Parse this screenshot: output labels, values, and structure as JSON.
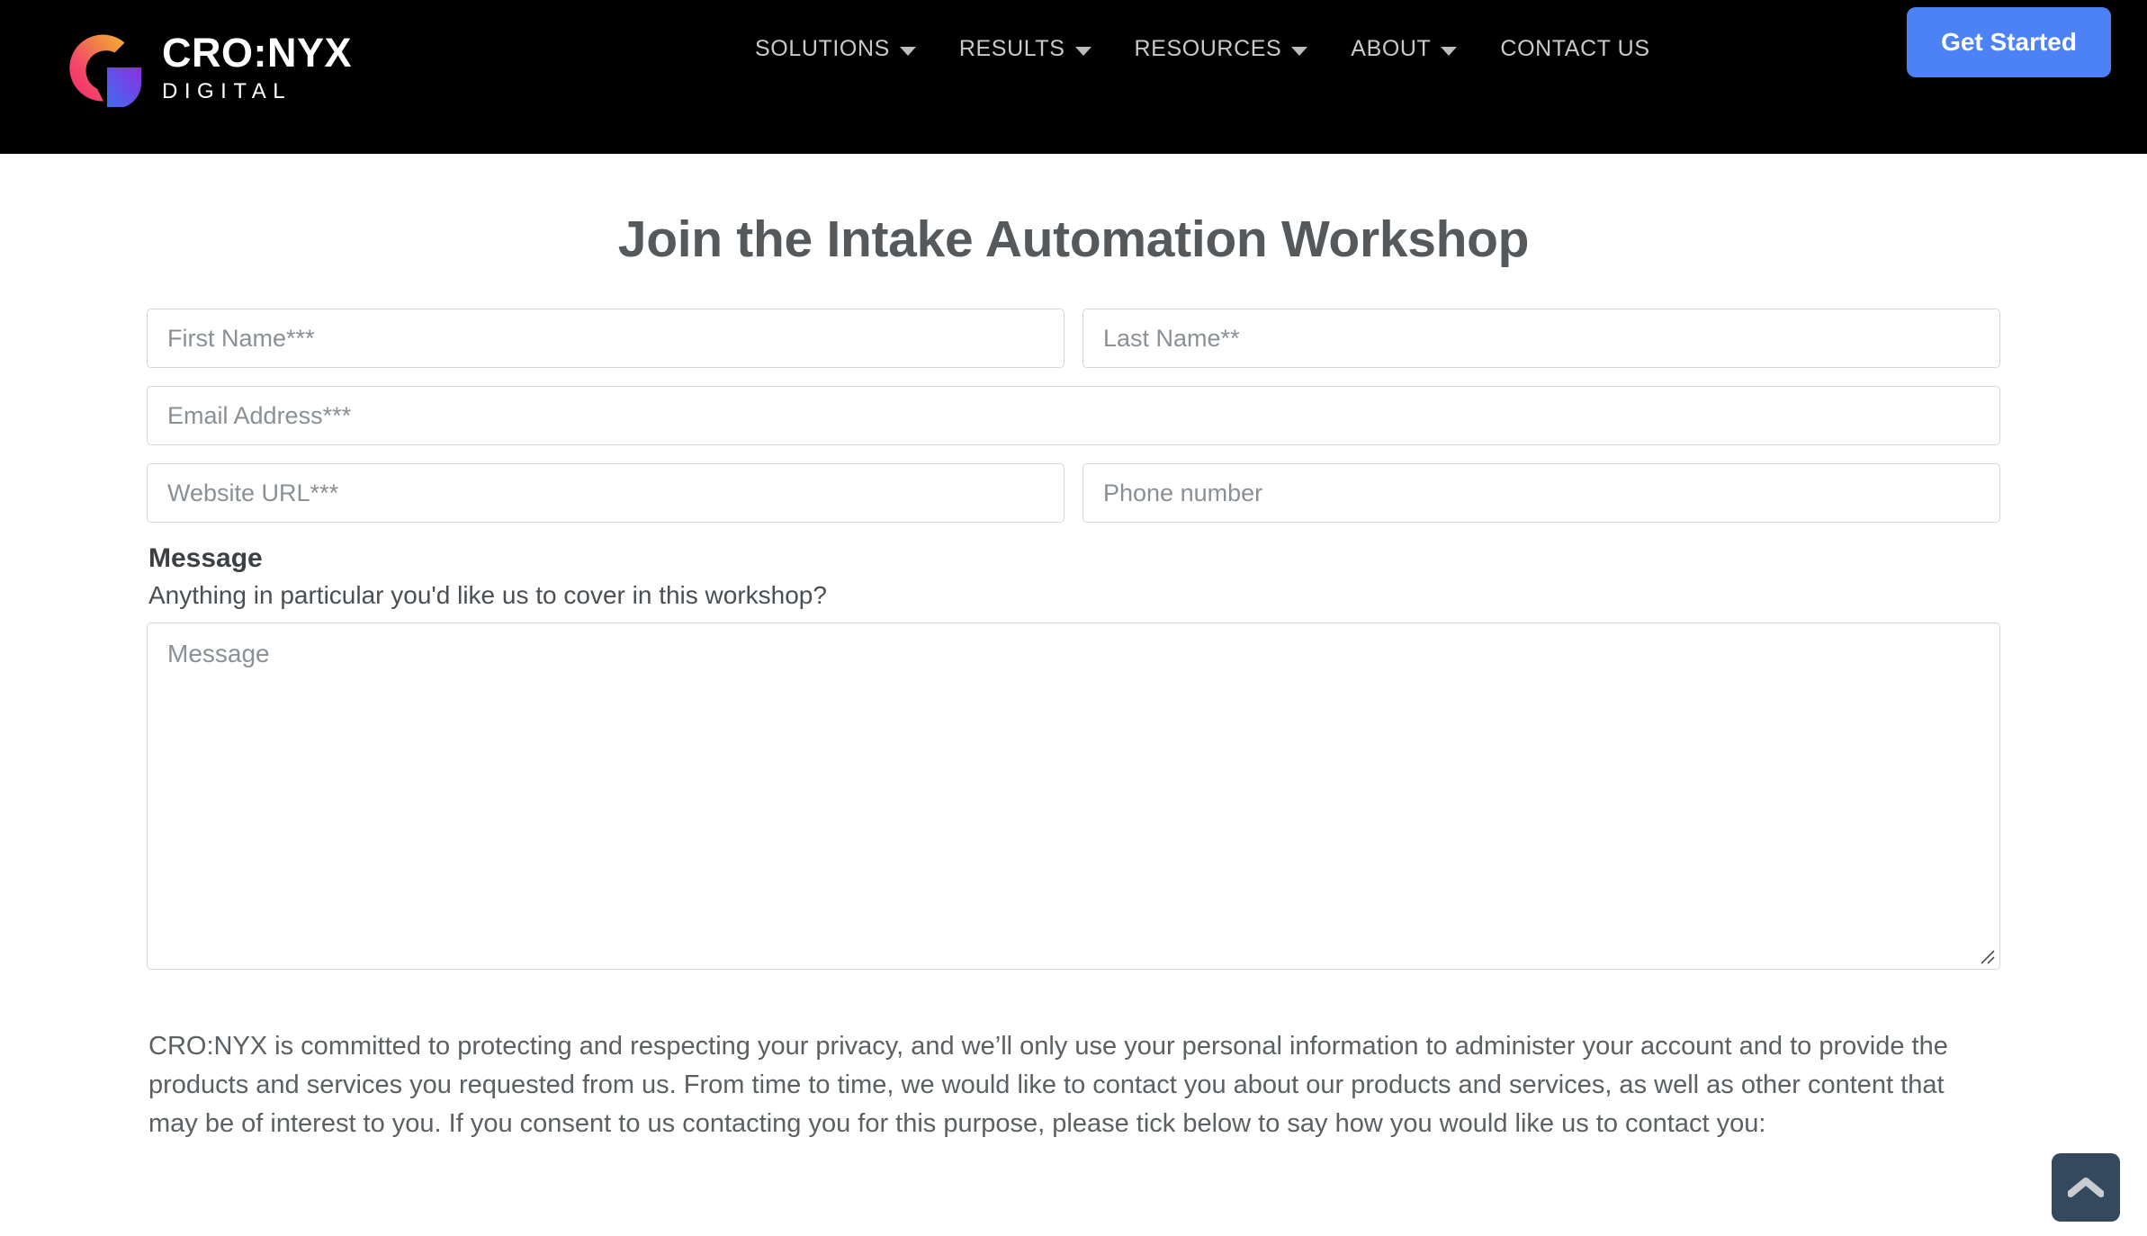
{
  "header": {
    "background_color": "#000000",
    "brand": {
      "name": "CRO:NYX",
      "sub": "DIGITAL",
      "logo_icon": "cronyx-g-logo-icon"
    },
    "nav_items": [
      {
        "label": "SOLUTIONS",
        "has_dropdown": true
      },
      {
        "label": "RESULTS",
        "has_dropdown": true
      },
      {
        "label": "RESOURCES",
        "has_dropdown": true
      },
      {
        "label": "ABOUT",
        "has_dropdown": true
      },
      {
        "label": "CONTACT US",
        "has_dropdown": false
      }
    ],
    "cta": {
      "label": "Get Started",
      "color": "#4d82f7"
    }
  },
  "main": {
    "title": "Join the Intake Automation Workshop",
    "fields": {
      "first_name": {
        "placeholder": "First Name***",
        "value": ""
      },
      "last_name": {
        "placeholder": "Last Name**",
        "value": ""
      },
      "email": {
        "placeholder": "Email Address***",
        "value": ""
      },
      "website": {
        "placeholder": "Website URL***",
        "value": ""
      },
      "phone": {
        "placeholder": "Phone number",
        "value": ""
      }
    },
    "message": {
      "label": "Message",
      "help": "Anything in particular you'd like us to cover in this workshop?",
      "placeholder": "Message",
      "value": ""
    },
    "privacy": "CRO:NYX is committed to protecting and respecting your privacy, and we’ll only use your personal information to administer your account and to provide the products and services you requested from us. From time to time, we would like to contact you about our products and services, as well as other content that may be of interest to you. If you consent to us contacting you for this purpose, please tick below to say how you would like us to contact you:"
  },
  "back_to_top": {
    "icon": "chevron-up-icon",
    "background_color": "#34495e",
    "icon_color": "#c8cdd2"
  }
}
